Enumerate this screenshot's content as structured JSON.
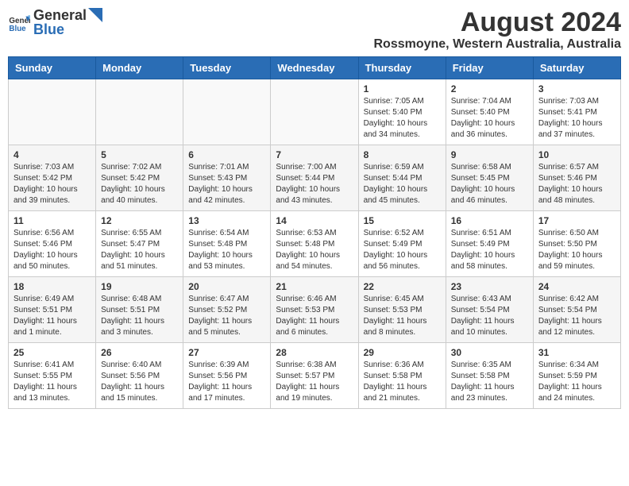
{
  "header": {
    "logo_general": "General",
    "logo_blue": "Blue",
    "title": "August 2024",
    "subtitle": "Rossmoyne, Western Australia, Australia"
  },
  "days_of_week": [
    "Sunday",
    "Monday",
    "Tuesday",
    "Wednesday",
    "Thursday",
    "Friday",
    "Saturday"
  ],
  "weeks": [
    [
      {
        "day": "",
        "info": "",
        "empty": true
      },
      {
        "day": "",
        "info": "",
        "empty": true
      },
      {
        "day": "",
        "info": "",
        "empty": true
      },
      {
        "day": "",
        "info": "",
        "empty": true
      },
      {
        "day": "1",
        "info": "Sunrise: 7:05 AM\nSunset: 5:40 PM\nDaylight: 10 hours\nand 34 minutes."
      },
      {
        "day": "2",
        "info": "Sunrise: 7:04 AM\nSunset: 5:40 PM\nDaylight: 10 hours\nand 36 minutes."
      },
      {
        "day": "3",
        "info": "Sunrise: 7:03 AM\nSunset: 5:41 PM\nDaylight: 10 hours\nand 37 minutes."
      }
    ],
    [
      {
        "day": "4",
        "info": "Sunrise: 7:03 AM\nSunset: 5:42 PM\nDaylight: 10 hours\nand 39 minutes."
      },
      {
        "day": "5",
        "info": "Sunrise: 7:02 AM\nSunset: 5:42 PM\nDaylight: 10 hours\nand 40 minutes."
      },
      {
        "day": "6",
        "info": "Sunrise: 7:01 AM\nSunset: 5:43 PM\nDaylight: 10 hours\nand 42 minutes."
      },
      {
        "day": "7",
        "info": "Sunrise: 7:00 AM\nSunset: 5:44 PM\nDaylight: 10 hours\nand 43 minutes."
      },
      {
        "day": "8",
        "info": "Sunrise: 6:59 AM\nSunset: 5:44 PM\nDaylight: 10 hours\nand 45 minutes."
      },
      {
        "day": "9",
        "info": "Sunrise: 6:58 AM\nSunset: 5:45 PM\nDaylight: 10 hours\nand 46 minutes."
      },
      {
        "day": "10",
        "info": "Sunrise: 6:57 AM\nSunset: 5:46 PM\nDaylight: 10 hours\nand 48 minutes."
      }
    ],
    [
      {
        "day": "11",
        "info": "Sunrise: 6:56 AM\nSunset: 5:46 PM\nDaylight: 10 hours\nand 50 minutes."
      },
      {
        "day": "12",
        "info": "Sunrise: 6:55 AM\nSunset: 5:47 PM\nDaylight: 10 hours\nand 51 minutes."
      },
      {
        "day": "13",
        "info": "Sunrise: 6:54 AM\nSunset: 5:48 PM\nDaylight: 10 hours\nand 53 minutes."
      },
      {
        "day": "14",
        "info": "Sunrise: 6:53 AM\nSunset: 5:48 PM\nDaylight: 10 hours\nand 54 minutes."
      },
      {
        "day": "15",
        "info": "Sunrise: 6:52 AM\nSunset: 5:49 PM\nDaylight: 10 hours\nand 56 minutes."
      },
      {
        "day": "16",
        "info": "Sunrise: 6:51 AM\nSunset: 5:49 PM\nDaylight: 10 hours\nand 58 minutes."
      },
      {
        "day": "17",
        "info": "Sunrise: 6:50 AM\nSunset: 5:50 PM\nDaylight: 10 hours\nand 59 minutes."
      }
    ],
    [
      {
        "day": "18",
        "info": "Sunrise: 6:49 AM\nSunset: 5:51 PM\nDaylight: 11 hours\nand 1 minute."
      },
      {
        "day": "19",
        "info": "Sunrise: 6:48 AM\nSunset: 5:51 PM\nDaylight: 11 hours\nand 3 minutes."
      },
      {
        "day": "20",
        "info": "Sunrise: 6:47 AM\nSunset: 5:52 PM\nDaylight: 11 hours\nand 5 minutes."
      },
      {
        "day": "21",
        "info": "Sunrise: 6:46 AM\nSunset: 5:53 PM\nDaylight: 11 hours\nand 6 minutes."
      },
      {
        "day": "22",
        "info": "Sunrise: 6:45 AM\nSunset: 5:53 PM\nDaylight: 11 hours\nand 8 minutes."
      },
      {
        "day": "23",
        "info": "Sunrise: 6:43 AM\nSunset: 5:54 PM\nDaylight: 11 hours\nand 10 minutes."
      },
      {
        "day": "24",
        "info": "Sunrise: 6:42 AM\nSunset: 5:54 PM\nDaylight: 11 hours\nand 12 minutes."
      }
    ],
    [
      {
        "day": "25",
        "info": "Sunrise: 6:41 AM\nSunset: 5:55 PM\nDaylight: 11 hours\nand 13 minutes."
      },
      {
        "day": "26",
        "info": "Sunrise: 6:40 AM\nSunset: 5:56 PM\nDaylight: 11 hours\nand 15 minutes."
      },
      {
        "day": "27",
        "info": "Sunrise: 6:39 AM\nSunset: 5:56 PM\nDaylight: 11 hours\nand 17 minutes."
      },
      {
        "day": "28",
        "info": "Sunrise: 6:38 AM\nSunset: 5:57 PM\nDaylight: 11 hours\nand 19 minutes."
      },
      {
        "day": "29",
        "info": "Sunrise: 6:36 AM\nSunset: 5:58 PM\nDaylight: 11 hours\nand 21 minutes."
      },
      {
        "day": "30",
        "info": "Sunrise: 6:35 AM\nSunset: 5:58 PM\nDaylight: 11 hours\nand 23 minutes."
      },
      {
        "day": "31",
        "info": "Sunrise: 6:34 AM\nSunset: 5:59 PM\nDaylight: 11 hours\nand 24 minutes."
      }
    ]
  ]
}
